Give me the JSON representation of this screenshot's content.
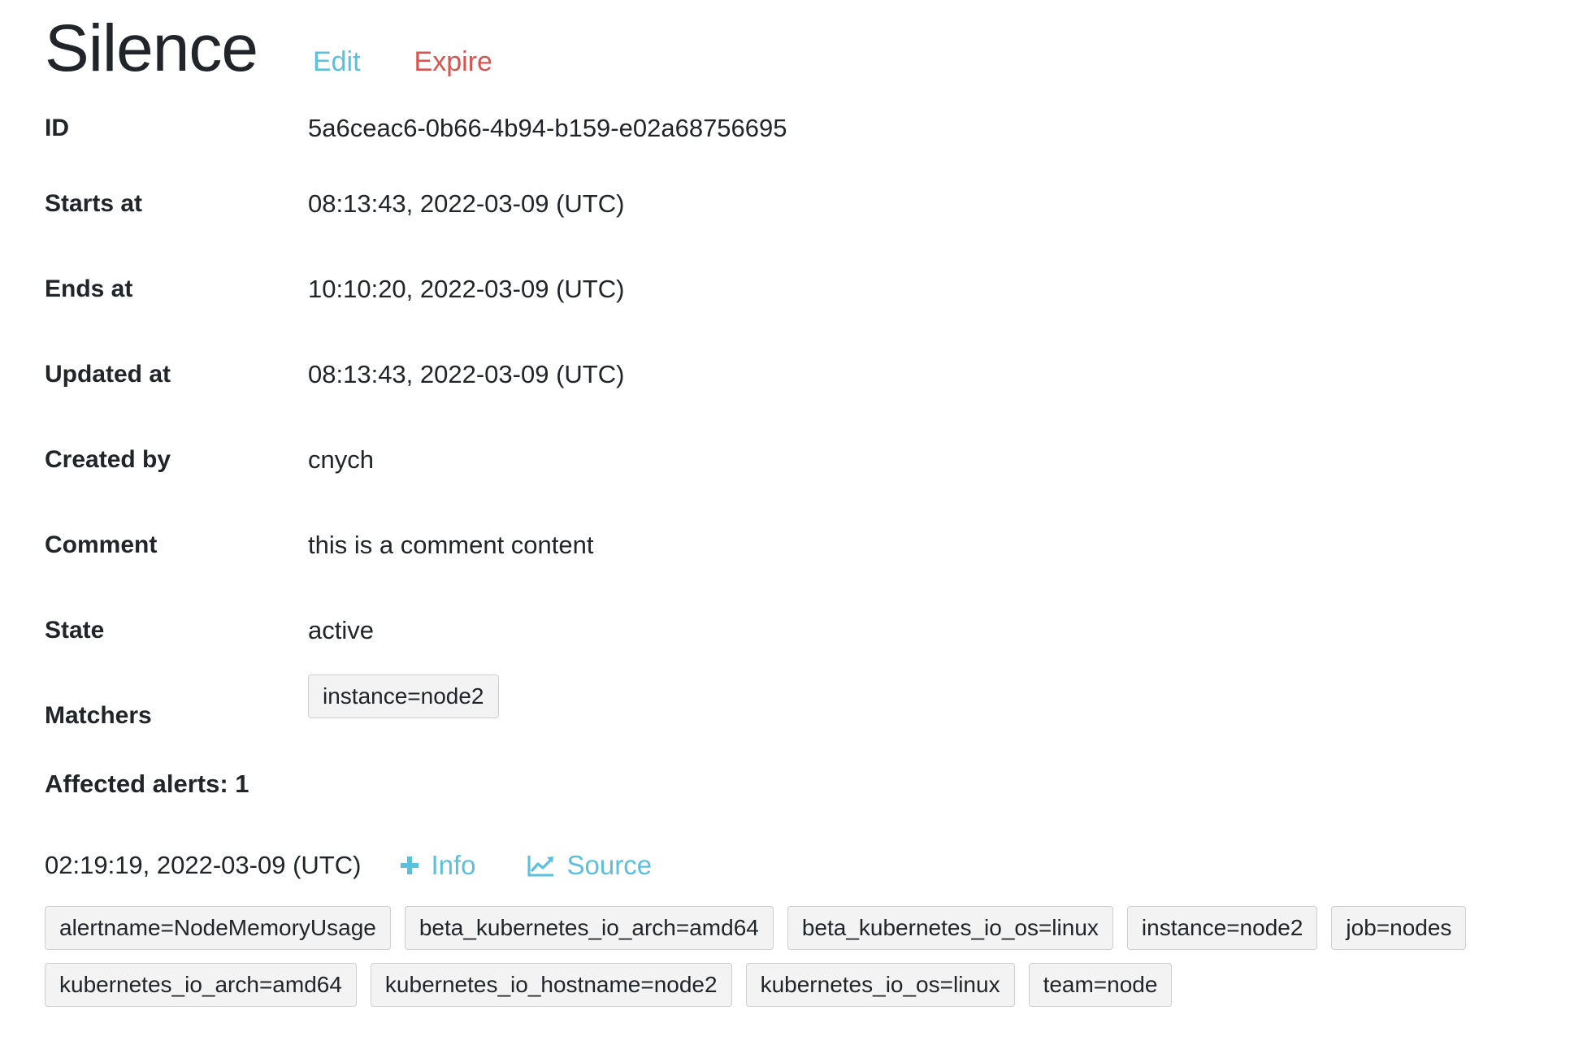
{
  "header": {
    "title": "Silence",
    "edit_label": "Edit",
    "expire_label": "Expire"
  },
  "details": [
    {
      "label": "ID",
      "value": "5a6ceac6-0b66-4b94-b159-e02a68756695"
    },
    {
      "label": "Starts at",
      "value": "08:13:43, 2022-03-09 (UTC)"
    },
    {
      "label": "Ends at",
      "value": "10:10:20, 2022-03-09 (UTC)"
    },
    {
      "label": "Updated at",
      "value": "08:13:43, 2022-03-09 (UTC)"
    },
    {
      "label": "Created by",
      "value": "cnych"
    },
    {
      "label": "Comment",
      "value": "this is a comment content"
    },
    {
      "label": "State",
      "value": "active"
    }
  ],
  "matchers": {
    "label": "Matchers",
    "items": [
      "instance=node2"
    ]
  },
  "affected": {
    "title": "Affected alerts: 1",
    "alerts": [
      {
        "time": "02:19:19, 2022-03-09 (UTC)",
        "info_label": "Info",
        "source_label": "Source",
        "labels_row1": [
          "alertname=NodeMemoryUsage",
          "beta_kubernetes_io_arch=amd64",
          "beta_kubernetes_io_os=linux",
          "instance=node2",
          "job=nodes"
        ],
        "labels_row2": [
          "kubernetes_io_arch=amd64",
          "kubernetes_io_hostname=node2",
          "kubernetes_io_os=linux",
          "team=node"
        ]
      }
    ]
  },
  "colors": {
    "link": "#5bc0de",
    "danger": "#d9534f",
    "text": "#212529",
    "tag_bg": "#f3f3f3",
    "tag_border": "#cfcfcf"
  },
  "icons": {
    "info": "plus-icon",
    "source": "line-chart-icon"
  }
}
